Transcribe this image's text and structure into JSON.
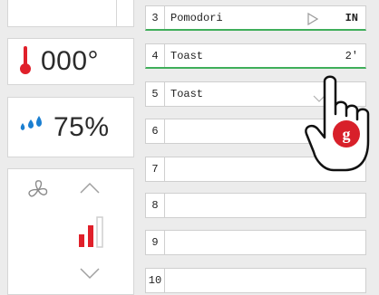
{
  "temperature": {
    "value": "000°"
  },
  "humidity": {
    "value": "75%"
  },
  "rows": [
    {
      "n": "3",
      "label": "Pomodori",
      "right": "IN",
      "icon": "play-outline-icon"
    },
    {
      "n": "4",
      "label": "Toast",
      "right": "2'"
    },
    {
      "n": "5",
      "label": "Toast",
      "right": ""
    },
    {
      "n": "6",
      "label": "",
      "right": ""
    },
    {
      "n": "7",
      "label": "",
      "right": ""
    },
    {
      "n": "8",
      "label": "",
      "right": ""
    },
    {
      "n": "9",
      "label": "",
      "right": ""
    },
    {
      "n": "10",
      "label": "",
      "right": ""
    }
  ],
  "hand_badge": "g",
  "icons": {
    "thermometer": "thermometer-icon",
    "humidity": "water-drops-icon",
    "fan": "fan-icon",
    "up": "chevron-up-icon",
    "down": "chevron-down-icon",
    "bars": "fan-speed-bars-icon",
    "hand": "pointing-hand-icon"
  },
  "colors": {
    "accent_green": "#3fae5a",
    "red": "#e0202a",
    "blue": "#1b7fd1"
  }
}
